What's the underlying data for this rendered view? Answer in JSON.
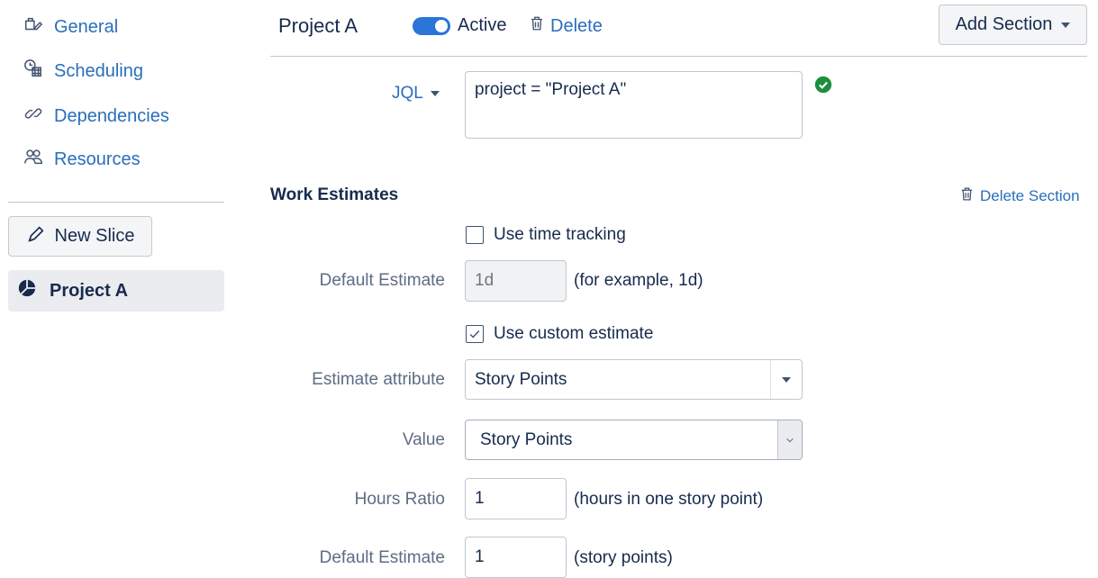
{
  "sidebar": {
    "items": [
      {
        "label": "General",
        "icon": "settings-pencil-icon"
      },
      {
        "label": "Scheduling",
        "icon": "calendar-clock-icon"
      },
      {
        "label": "Dependencies",
        "icon": "link-icon"
      },
      {
        "label": "Resources",
        "icon": "people-icon"
      }
    ],
    "new_slice_label": "New Slice",
    "active_slice": "Project A"
  },
  "header": {
    "title": "Project A",
    "active_label": "Active",
    "active_on": true,
    "delete_label": "Delete",
    "add_section_label": "Add Section"
  },
  "jql": {
    "label": "JQL",
    "value": "project = \"Project A\"",
    "valid": true
  },
  "work_estimates": {
    "title": "Work Estimates",
    "delete_section_label": "Delete Section",
    "use_time_tracking": {
      "label": "Use time tracking",
      "checked": false
    },
    "default_estimate_time": {
      "label": "Default Estimate",
      "placeholder": "1d",
      "hint": "(for example, 1d)"
    },
    "use_custom_estimate": {
      "label": "Use custom estimate",
      "checked": true
    },
    "estimate_attribute": {
      "label": "Estimate attribute",
      "value": "Story Points"
    },
    "value_field": {
      "label": "Value",
      "value": "Story Points"
    },
    "hours_ratio": {
      "label": "Hours Ratio",
      "value": "1",
      "hint": "(hours in one story point)"
    },
    "default_estimate_points": {
      "label": "Default Estimate",
      "value": "1",
      "hint": "(story points)"
    }
  },
  "colors": {
    "link": "#2a6ebb",
    "toggle": "#2b74d8",
    "success": "#1e8e3e"
  }
}
